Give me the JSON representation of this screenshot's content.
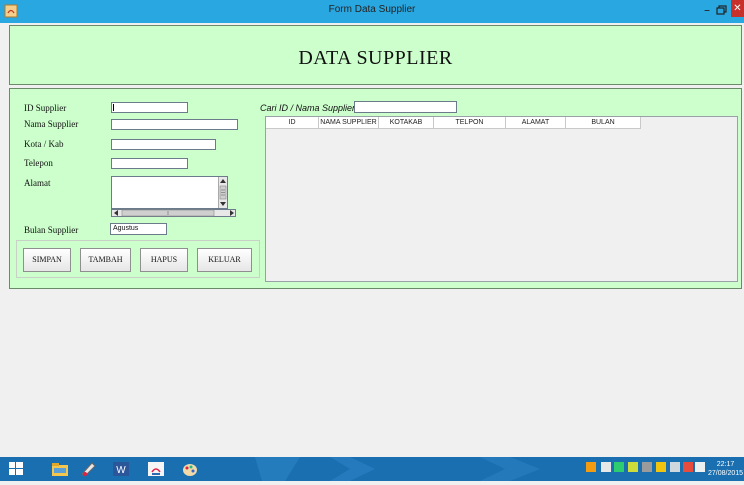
{
  "window": {
    "title": "Form Data Supplier"
  },
  "header": {
    "title": "DATA SUPPLIER"
  },
  "form": {
    "id_label": "ID Supplier",
    "nama_label": "Nama Supplier",
    "kota_label": "Kota / Kab",
    "telepon_label": "Telepon",
    "alamat_label": "Alamat",
    "bulan_label": "Bulan Supplier",
    "bulan_value": "Agustus"
  },
  "buttons": {
    "simpan": "SIMPAN",
    "tambah": "TAMBAH",
    "hapus": "HAPUS",
    "keluar": "KELUAR"
  },
  "search": {
    "label": "Cari ID / Nama Supplier :"
  },
  "table": {
    "columns": [
      "ID",
      "NAMA SUPPLIER",
      "KOTAKAB",
      "TELPON",
      "ALAMAT",
      "BULAN"
    ]
  },
  "taskbar": {
    "apps": [
      "windows-start-icon",
      "file-explorer-icon",
      "paint-app-icon",
      "word-icon",
      "java-icon",
      "paint-icon"
    ],
    "clock_time": "22:17",
    "clock_date": "27/08/2015"
  },
  "colors": {
    "panel_bg": "#ccffcc",
    "title_bar": "#29a7e1",
    "taskbar": "#1a6fb0",
    "close_button": "#c7302b"
  }
}
